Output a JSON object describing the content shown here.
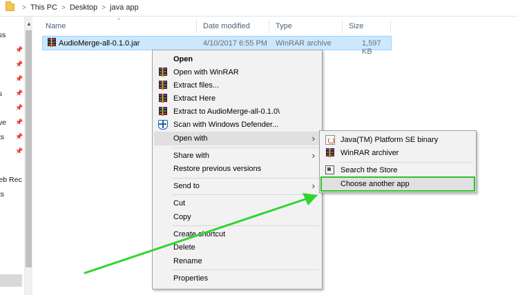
{
  "breadcrumb": [
    "This PC",
    "Desktop",
    "java app"
  ],
  "nav_items": [
    {
      "label": "ess",
      "pinned": false
    },
    {
      "label": "",
      "pinned": true
    },
    {
      "label": "",
      "pinned": true
    },
    {
      "label": "",
      "pinned": true
    },
    {
      "label": "ds",
      "pinned": true
    },
    {
      "label": "",
      "pinned": true
    },
    {
      "label": "rive",
      "pinned": true
    },
    {
      "label": "nts",
      "pinned": true
    },
    {
      "label": "",
      "pinned": true
    },
    {
      "label": "l",
      "pinned": false
    },
    {
      "label": "Veb Rec",
      "pinned": false
    },
    {
      "label": "ots",
      "pinned": false
    }
  ],
  "columns": {
    "name": "Name",
    "date": "Date modified",
    "type": "Type",
    "size": "Size"
  },
  "file": {
    "name": "AudioMerge-all-0.1.0.jar",
    "date": "4/10/2017 6:55 PM",
    "type": "WinRAR archive",
    "size": "1,597 KB"
  },
  "context_menu": {
    "open": "Open",
    "open_with_winrar": "Open with WinRAR",
    "extract_files": "Extract files...",
    "extract_here": "Extract Here",
    "extract_to": "Extract to AudioMerge-all-0.1.0\\",
    "scan_defender": "Scan with Windows Defender...",
    "open_with": "Open with",
    "share_with": "Share with",
    "restore_previous": "Restore previous versions",
    "send_to": "Send to",
    "cut": "Cut",
    "copy": "Copy",
    "create_shortcut": "Create shortcut",
    "delete": "Delete",
    "rename": "Rename",
    "properties": "Properties"
  },
  "submenu": {
    "java_binary": "Java(TM) Platform SE binary",
    "winrar_archiver": "WinRAR archiver",
    "search_store": "Search the Store",
    "choose_another": "Choose another app"
  },
  "colors": {
    "selection_bg": "#cce8ff",
    "menu_bg": "#f2f2f2",
    "highlight_green": "#2fbf2f"
  }
}
